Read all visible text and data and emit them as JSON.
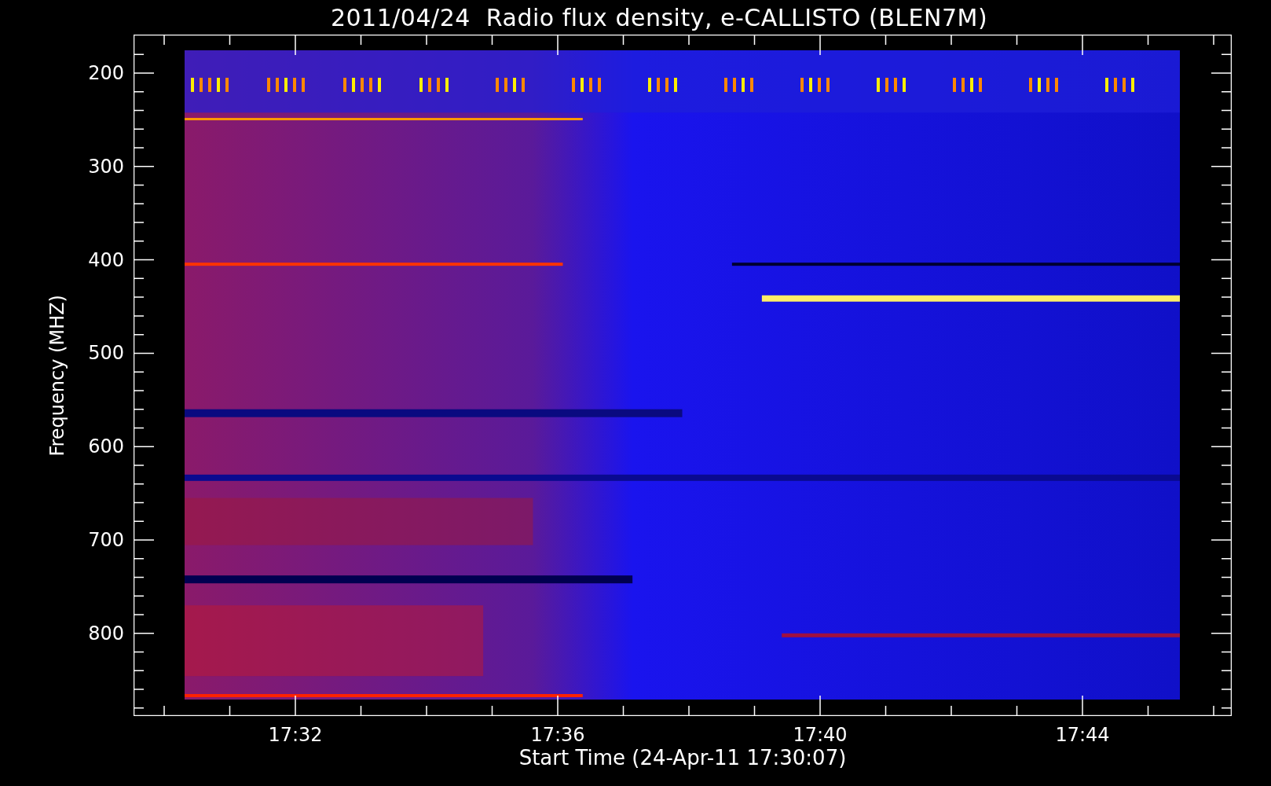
{
  "title": "2011/04/24  Radio flux density, e-CALLISTO (BLEN7M)",
  "y_axis": {
    "label": "Frequency (MHZ)",
    "ticks": [
      "200",
      "300",
      "400",
      "500",
      "600",
      "700",
      "800"
    ]
  },
  "x_axis": {
    "label": "Start Time (24-Apr-11 17:30:07)",
    "ticks": [
      "17:32",
      "17:36",
      "17:40",
      "17:44"
    ]
  }
}
